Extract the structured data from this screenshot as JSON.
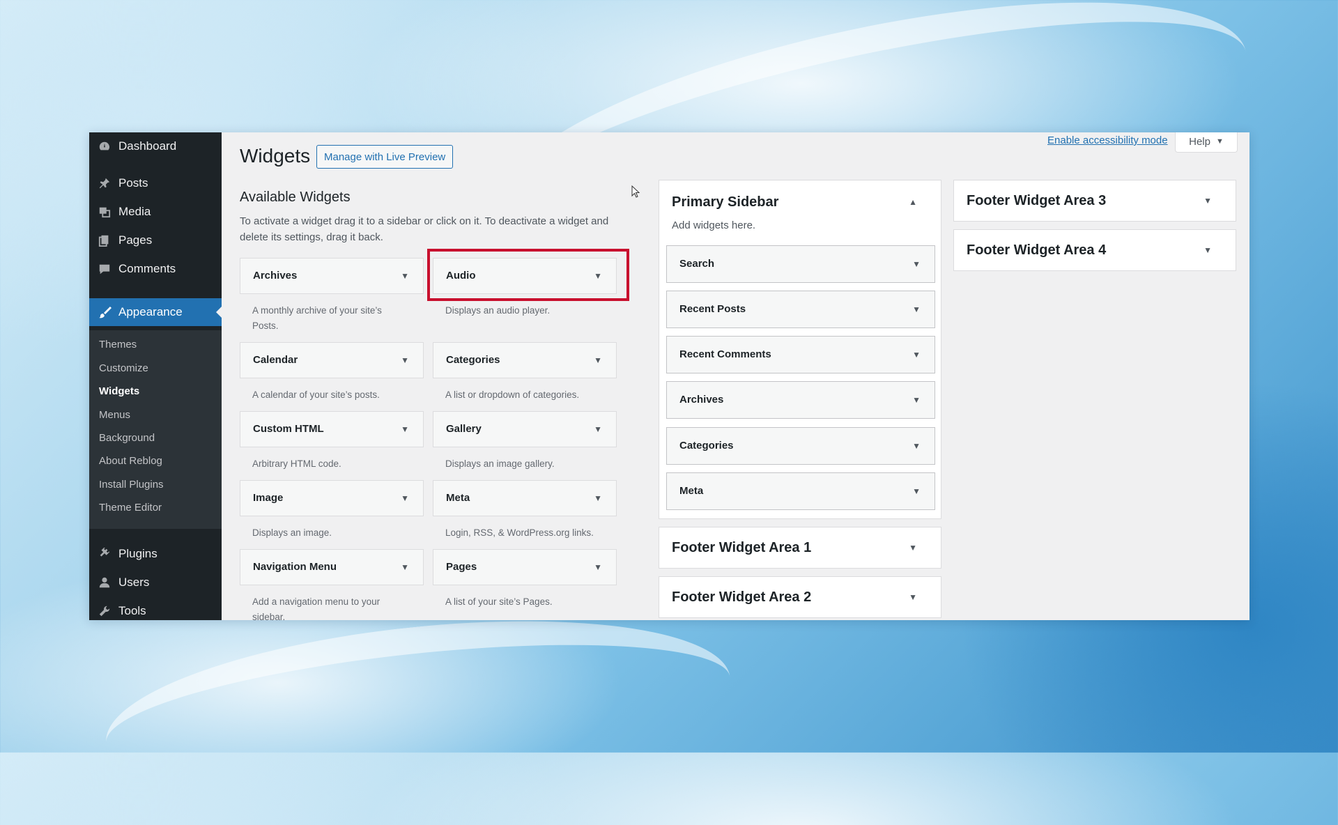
{
  "sidebar": {
    "top_items": [
      {
        "label": "Dashboard",
        "icon": "dashboard-icon"
      },
      {
        "label": "Posts",
        "icon": "pin-icon"
      },
      {
        "label": "Media",
        "icon": "media-icon"
      },
      {
        "label": "Pages",
        "icon": "pages-icon"
      },
      {
        "label": "Comments",
        "icon": "comment-icon"
      }
    ],
    "appearance": {
      "label": "Appearance",
      "icon": "brush-icon"
    },
    "submenu": [
      "Themes",
      "Customize",
      "Widgets",
      "Menus",
      "Background",
      "About Reblog",
      "Install Plugins",
      "Theme Editor"
    ],
    "bottom_items": [
      {
        "label": "Plugins",
        "icon": "plugin-icon"
      },
      {
        "label": "Users",
        "icon": "user-icon"
      },
      {
        "label": "Tools",
        "icon": "wrench-icon"
      }
    ],
    "active_color": "#2271b1"
  },
  "header": {
    "title": "Widgets",
    "live_preview": "Manage with Live Preview",
    "a11y_link": "Enable accessibility mode",
    "help": "Help"
  },
  "available": {
    "title": "Available Widgets",
    "description": "To activate a widget drag it to a sidebar or click on it. To deactivate a widget and delete its settings, drag it back.",
    "widgets": [
      {
        "name": "Archives",
        "desc": "A monthly archive of your site’s Posts."
      },
      {
        "name": "Audio",
        "desc": "Displays an audio player."
      },
      {
        "name": "Calendar",
        "desc": "A calendar of your site’s posts."
      },
      {
        "name": "Categories",
        "desc": "A list or dropdown of categories."
      },
      {
        "name": "Custom HTML",
        "desc": "Arbitrary HTML code."
      },
      {
        "name": "Gallery",
        "desc": "Displays an image gallery."
      },
      {
        "name": "Image",
        "desc": "Displays an image."
      },
      {
        "name": "Meta",
        "desc": "Login, RSS, & WordPress.org links."
      },
      {
        "name": "Navigation Menu",
        "desc": "Add a navigation menu to your sidebar."
      },
      {
        "name": "Pages",
        "desc": "A list of your site’s Pages."
      }
    ],
    "highlight_color": "#c8102e"
  },
  "primary_sidebar": {
    "title": "Primary Sidebar",
    "hint": "Add widgets here.",
    "widgets": [
      "Search",
      "Recent Posts",
      "Recent Comments",
      "Archives",
      "Categories",
      "Meta"
    ]
  },
  "footer_areas": [
    "Footer Widget Area 1",
    "Footer Widget Area 2",
    "Footer Widget Area 3",
    "Footer Widget Area 4"
  ]
}
